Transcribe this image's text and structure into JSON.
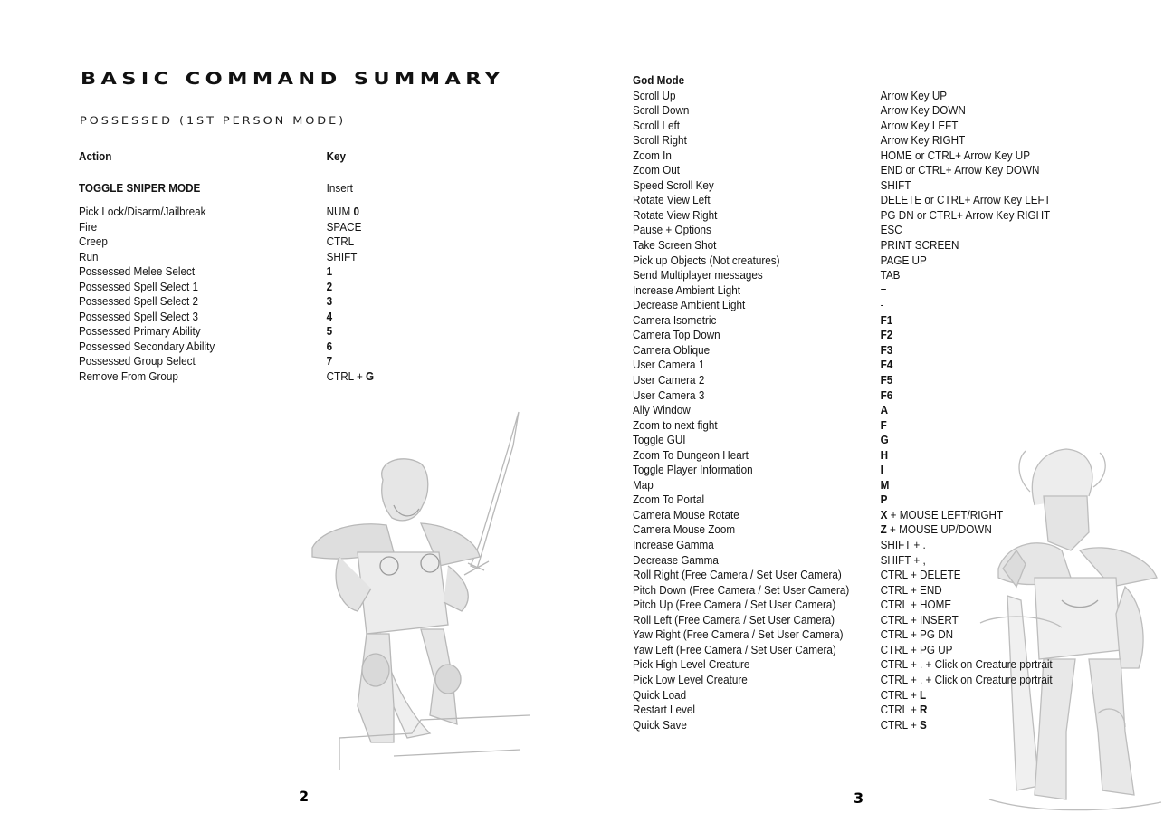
{
  "left_page": {
    "title": "BASIC COMMAND SUMMARY",
    "subtitle": "POSSESSED (1ST PERSON MODE)",
    "header": {
      "action": "Action",
      "key": "Key"
    },
    "featured": {
      "action": "TOGGLE SNIPER MODE",
      "key": "Insert"
    },
    "rows": [
      {
        "action": "Pick Lock/Disarm/Jailbreak",
        "key_prefix": "NUM ",
        "key_bold": "0",
        "key_suffix": ""
      },
      {
        "action": "Fire",
        "key_prefix": "SPACE",
        "key_bold": "",
        "key_suffix": ""
      },
      {
        "action": "Creep",
        "key_prefix": "CTRL",
        "key_bold": "",
        "key_suffix": ""
      },
      {
        "action": "Run",
        "key_prefix": "SHIFT",
        "key_bold": "",
        "key_suffix": ""
      },
      {
        "action": "Possessed Melee Select",
        "key_prefix": "",
        "key_bold": "1",
        "key_suffix": ""
      },
      {
        "action": "Possessed Spell Select 1",
        "key_prefix": "",
        "key_bold": "2",
        "key_suffix": ""
      },
      {
        "action": "Possessed Spell Select 2",
        "key_prefix": "",
        "key_bold": "3",
        "key_suffix": ""
      },
      {
        "action": "Possessed Spell Select 3",
        "key_prefix": "",
        "key_bold": "4",
        "key_suffix": ""
      },
      {
        "action": "Possessed Primary Ability",
        "key_prefix": "",
        "key_bold": "5",
        "key_suffix": ""
      },
      {
        "action": "Possessed Secondary Ability",
        "key_prefix": "",
        "key_bold": "6",
        "key_suffix": ""
      },
      {
        "action": "Possessed Group Select",
        "key_prefix": "",
        "key_bold": "7",
        "key_suffix": ""
      },
      {
        "action": "Remove From Group",
        "key_prefix": "CTRL + ",
        "key_bold": "G",
        "key_suffix": ""
      }
    ],
    "illustration": "knight-with-sword-sketch",
    "page_number": "2"
  },
  "right_page": {
    "section_title": "God Mode",
    "rows": [
      {
        "action": "Scroll Up",
        "key_prefix": "Arrow Key UP",
        "key_bold": "",
        "key_suffix": ""
      },
      {
        "action": "Scroll Down",
        "key_prefix": "Arrow Key DOWN",
        "key_bold": "",
        "key_suffix": ""
      },
      {
        "action": "Scroll Left",
        "key_prefix": "Arrow Key LEFT",
        "key_bold": "",
        "key_suffix": ""
      },
      {
        "action": "Scroll Right",
        "key_prefix": "Arrow Key RIGHT",
        "key_bold": "",
        "key_suffix": ""
      },
      {
        "action": "Zoom In",
        "key_prefix": "HOME or CTRL+ Arrow Key UP",
        "key_bold": "",
        "key_suffix": ""
      },
      {
        "action": "Zoom Out",
        "key_prefix": "END or CTRL+ Arrow Key DOWN",
        "key_bold": "",
        "key_suffix": ""
      },
      {
        "action": "Speed Scroll Key",
        "key_prefix": "SHIFT",
        "key_bold": "",
        "key_suffix": ""
      },
      {
        "action": "Rotate View Left",
        "key_prefix": "DELETE or CTRL+ Arrow Key LEFT",
        "key_bold": "",
        "key_suffix": ""
      },
      {
        "action": "Rotate View Right",
        "key_prefix": "PG DN or CTRL+ Arrow Key RIGHT",
        "key_bold": "",
        "key_suffix": ""
      },
      {
        "action": "Pause + Options",
        "key_prefix": "ESC",
        "key_bold": "",
        "key_suffix": ""
      },
      {
        "action": "Take Screen Shot",
        "key_prefix": "PRINT SCREEN",
        "key_bold": "",
        "key_suffix": ""
      },
      {
        "action": "Pick up Objects (Not creatures)",
        "key_prefix": "PAGE UP",
        "key_bold": "",
        "key_suffix": ""
      },
      {
        "action": "Send Multiplayer messages",
        "key_prefix": "TAB",
        "key_bold": "",
        "key_suffix": ""
      },
      {
        "action": "Increase Ambient Light",
        "key_prefix": "=",
        "key_bold": "",
        "key_suffix": ""
      },
      {
        "action": "Decrease Ambient Light",
        "key_prefix": "-",
        "key_bold": "",
        "key_suffix": ""
      },
      {
        "action": "Camera Isometric",
        "key_prefix": "",
        "key_bold": "F1",
        "key_suffix": ""
      },
      {
        "action": "Camera Top Down",
        "key_prefix": "",
        "key_bold": "F2",
        "key_suffix": ""
      },
      {
        "action": "Camera Oblique",
        "key_prefix": "",
        "key_bold": "F3",
        "key_suffix": ""
      },
      {
        "action": "User Camera 1",
        "key_prefix": "",
        "key_bold": "F4",
        "key_suffix": ""
      },
      {
        "action": "User Camera 2",
        "key_prefix": "",
        "key_bold": "F5",
        "key_suffix": ""
      },
      {
        "action": "User Camera 3",
        "key_prefix": "",
        "key_bold": "F6",
        "key_suffix": ""
      },
      {
        "action": "Ally Window",
        "key_prefix": "",
        "key_bold": "A",
        "key_suffix": ""
      },
      {
        "action": "Zoom to next fight",
        "key_prefix": "",
        "key_bold": "F",
        "key_suffix": ""
      },
      {
        "action": "Toggle GUI",
        "key_prefix": "",
        "key_bold": "G",
        "key_suffix": ""
      },
      {
        "action": "Zoom To Dungeon Heart",
        "key_prefix": "",
        "key_bold": "H",
        "key_suffix": ""
      },
      {
        "action": "Toggle Player Information",
        "key_prefix": "",
        "key_bold": "I",
        "key_suffix": ""
      },
      {
        "action": "Map",
        "key_prefix": "",
        "key_bold": "M",
        "key_suffix": ""
      },
      {
        "action": "Zoom To Portal",
        "key_prefix": "",
        "key_bold": "P",
        "key_suffix": ""
      },
      {
        "action": "Camera Mouse Rotate",
        "key_prefix": "",
        "key_bold": "X",
        "key_suffix": " + MOUSE LEFT/RIGHT"
      },
      {
        "action": "Camera Mouse Zoom",
        "key_prefix": "",
        "key_bold": "Z",
        "key_suffix": " + MOUSE UP/DOWN"
      },
      {
        "action": "Increase Gamma",
        "key_prefix": "SHIFT + .",
        "key_bold": "",
        "key_suffix": ""
      },
      {
        "action": "Decrease Gamma",
        "key_prefix": "SHIFT + ,",
        "key_bold": "",
        "key_suffix": ""
      },
      {
        "action": "Roll Right (Free Camera / Set User Camera)",
        "key_prefix": "CTRL + DELETE",
        "key_bold": "",
        "key_suffix": ""
      },
      {
        "action": "Pitch Down (Free Camera / Set User Camera)",
        "key_prefix": "CTRL + END",
        "key_bold": "",
        "key_suffix": ""
      },
      {
        "action": "Pitch Up (Free Camera / Set User Camera)",
        "key_prefix": "CTRL + HOME",
        "key_bold": "",
        "key_suffix": ""
      },
      {
        "action": "Roll Left (Free Camera / Set User Camera)",
        "key_prefix": "CTRL + INSERT",
        "key_bold": "",
        "key_suffix": ""
      },
      {
        "action": "Yaw Right (Free Camera / Set User Camera)",
        "key_prefix": "CTRL + PG DN",
        "key_bold": "",
        "key_suffix": ""
      },
      {
        "action": "Yaw Left (Free Camera / Set User Camera)",
        "key_prefix": "CTRL + PG UP",
        "key_bold": "",
        "key_suffix": ""
      },
      {
        "action": "Pick High Level Creature",
        "key_prefix": "CTRL + . + Click on Creature portrait",
        "key_bold": "",
        "key_suffix": ""
      },
      {
        "action": "Pick Low Level Creature",
        "key_prefix": "CTRL + , + Click on Creature portrait",
        "key_bold": "",
        "key_suffix": ""
      },
      {
        "action": "Quick Load",
        "key_prefix": "CTRL + ",
        "key_bold": "L",
        "key_suffix": ""
      },
      {
        "action": "Restart Level",
        "key_prefix": "CTRL + ",
        "key_bold": "R",
        "key_suffix": ""
      },
      {
        "action": "Quick Save",
        "key_prefix": "CTRL + ",
        "key_bold": "S",
        "key_suffix": ""
      }
    ],
    "illustration": "armored-horned-knight-sketch",
    "page_number": "3"
  }
}
